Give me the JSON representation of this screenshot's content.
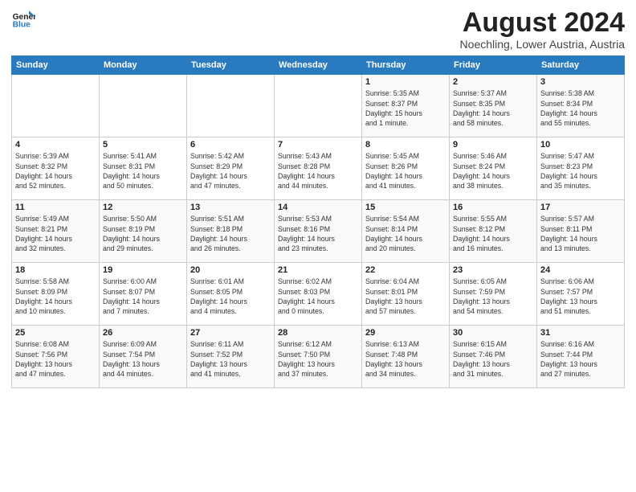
{
  "header": {
    "logo_line1": "General",
    "logo_line2": "Blue",
    "title": "August 2024",
    "subtitle": "Noechling, Lower Austria, Austria"
  },
  "weekdays": [
    "Sunday",
    "Monday",
    "Tuesday",
    "Wednesday",
    "Thursday",
    "Friday",
    "Saturday"
  ],
  "weeks": [
    [
      {
        "day": "",
        "info": ""
      },
      {
        "day": "",
        "info": ""
      },
      {
        "day": "",
        "info": ""
      },
      {
        "day": "",
        "info": ""
      },
      {
        "day": "1",
        "info": "Sunrise: 5:35 AM\nSunset: 8:37 PM\nDaylight: 15 hours\nand 1 minute."
      },
      {
        "day": "2",
        "info": "Sunrise: 5:37 AM\nSunset: 8:35 PM\nDaylight: 14 hours\nand 58 minutes."
      },
      {
        "day": "3",
        "info": "Sunrise: 5:38 AM\nSunset: 8:34 PM\nDaylight: 14 hours\nand 55 minutes."
      }
    ],
    [
      {
        "day": "4",
        "info": "Sunrise: 5:39 AM\nSunset: 8:32 PM\nDaylight: 14 hours\nand 52 minutes."
      },
      {
        "day": "5",
        "info": "Sunrise: 5:41 AM\nSunset: 8:31 PM\nDaylight: 14 hours\nand 50 minutes."
      },
      {
        "day": "6",
        "info": "Sunrise: 5:42 AM\nSunset: 8:29 PM\nDaylight: 14 hours\nand 47 minutes."
      },
      {
        "day": "7",
        "info": "Sunrise: 5:43 AM\nSunset: 8:28 PM\nDaylight: 14 hours\nand 44 minutes."
      },
      {
        "day": "8",
        "info": "Sunrise: 5:45 AM\nSunset: 8:26 PM\nDaylight: 14 hours\nand 41 minutes."
      },
      {
        "day": "9",
        "info": "Sunrise: 5:46 AM\nSunset: 8:24 PM\nDaylight: 14 hours\nand 38 minutes."
      },
      {
        "day": "10",
        "info": "Sunrise: 5:47 AM\nSunset: 8:23 PM\nDaylight: 14 hours\nand 35 minutes."
      }
    ],
    [
      {
        "day": "11",
        "info": "Sunrise: 5:49 AM\nSunset: 8:21 PM\nDaylight: 14 hours\nand 32 minutes."
      },
      {
        "day": "12",
        "info": "Sunrise: 5:50 AM\nSunset: 8:19 PM\nDaylight: 14 hours\nand 29 minutes."
      },
      {
        "day": "13",
        "info": "Sunrise: 5:51 AM\nSunset: 8:18 PM\nDaylight: 14 hours\nand 26 minutes."
      },
      {
        "day": "14",
        "info": "Sunrise: 5:53 AM\nSunset: 8:16 PM\nDaylight: 14 hours\nand 23 minutes."
      },
      {
        "day": "15",
        "info": "Sunrise: 5:54 AM\nSunset: 8:14 PM\nDaylight: 14 hours\nand 20 minutes."
      },
      {
        "day": "16",
        "info": "Sunrise: 5:55 AM\nSunset: 8:12 PM\nDaylight: 14 hours\nand 16 minutes."
      },
      {
        "day": "17",
        "info": "Sunrise: 5:57 AM\nSunset: 8:11 PM\nDaylight: 14 hours\nand 13 minutes."
      }
    ],
    [
      {
        "day": "18",
        "info": "Sunrise: 5:58 AM\nSunset: 8:09 PM\nDaylight: 14 hours\nand 10 minutes."
      },
      {
        "day": "19",
        "info": "Sunrise: 6:00 AM\nSunset: 8:07 PM\nDaylight: 14 hours\nand 7 minutes."
      },
      {
        "day": "20",
        "info": "Sunrise: 6:01 AM\nSunset: 8:05 PM\nDaylight: 14 hours\nand 4 minutes."
      },
      {
        "day": "21",
        "info": "Sunrise: 6:02 AM\nSunset: 8:03 PM\nDaylight: 14 hours\nand 0 minutes."
      },
      {
        "day": "22",
        "info": "Sunrise: 6:04 AM\nSunset: 8:01 PM\nDaylight: 13 hours\nand 57 minutes."
      },
      {
        "day": "23",
        "info": "Sunrise: 6:05 AM\nSunset: 7:59 PM\nDaylight: 13 hours\nand 54 minutes."
      },
      {
        "day": "24",
        "info": "Sunrise: 6:06 AM\nSunset: 7:57 PM\nDaylight: 13 hours\nand 51 minutes."
      }
    ],
    [
      {
        "day": "25",
        "info": "Sunrise: 6:08 AM\nSunset: 7:56 PM\nDaylight: 13 hours\nand 47 minutes."
      },
      {
        "day": "26",
        "info": "Sunrise: 6:09 AM\nSunset: 7:54 PM\nDaylight: 13 hours\nand 44 minutes."
      },
      {
        "day": "27",
        "info": "Sunrise: 6:11 AM\nSunset: 7:52 PM\nDaylight: 13 hours\nand 41 minutes."
      },
      {
        "day": "28",
        "info": "Sunrise: 6:12 AM\nSunset: 7:50 PM\nDaylight: 13 hours\nand 37 minutes."
      },
      {
        "day": "29",
        "info": "Sunrise: 6:13 AM\nSunset: 7:48 PM\nDaylight: 13 hours\nand 34 minutes."
      },
      {
        "day": "30",
        "info": "Sunrise: 6:15 AM\nSunset: 7:46 PM\nDaylight: 13 hours\nand 31 minutes."
      },
      {
        "day": "31",
        "info": "Sunrise: 6:16 AM\nSunset: 7:44 PM\nDaylight: 13 hours\nand 27 minutes."
      }
    ]
  ]
}
